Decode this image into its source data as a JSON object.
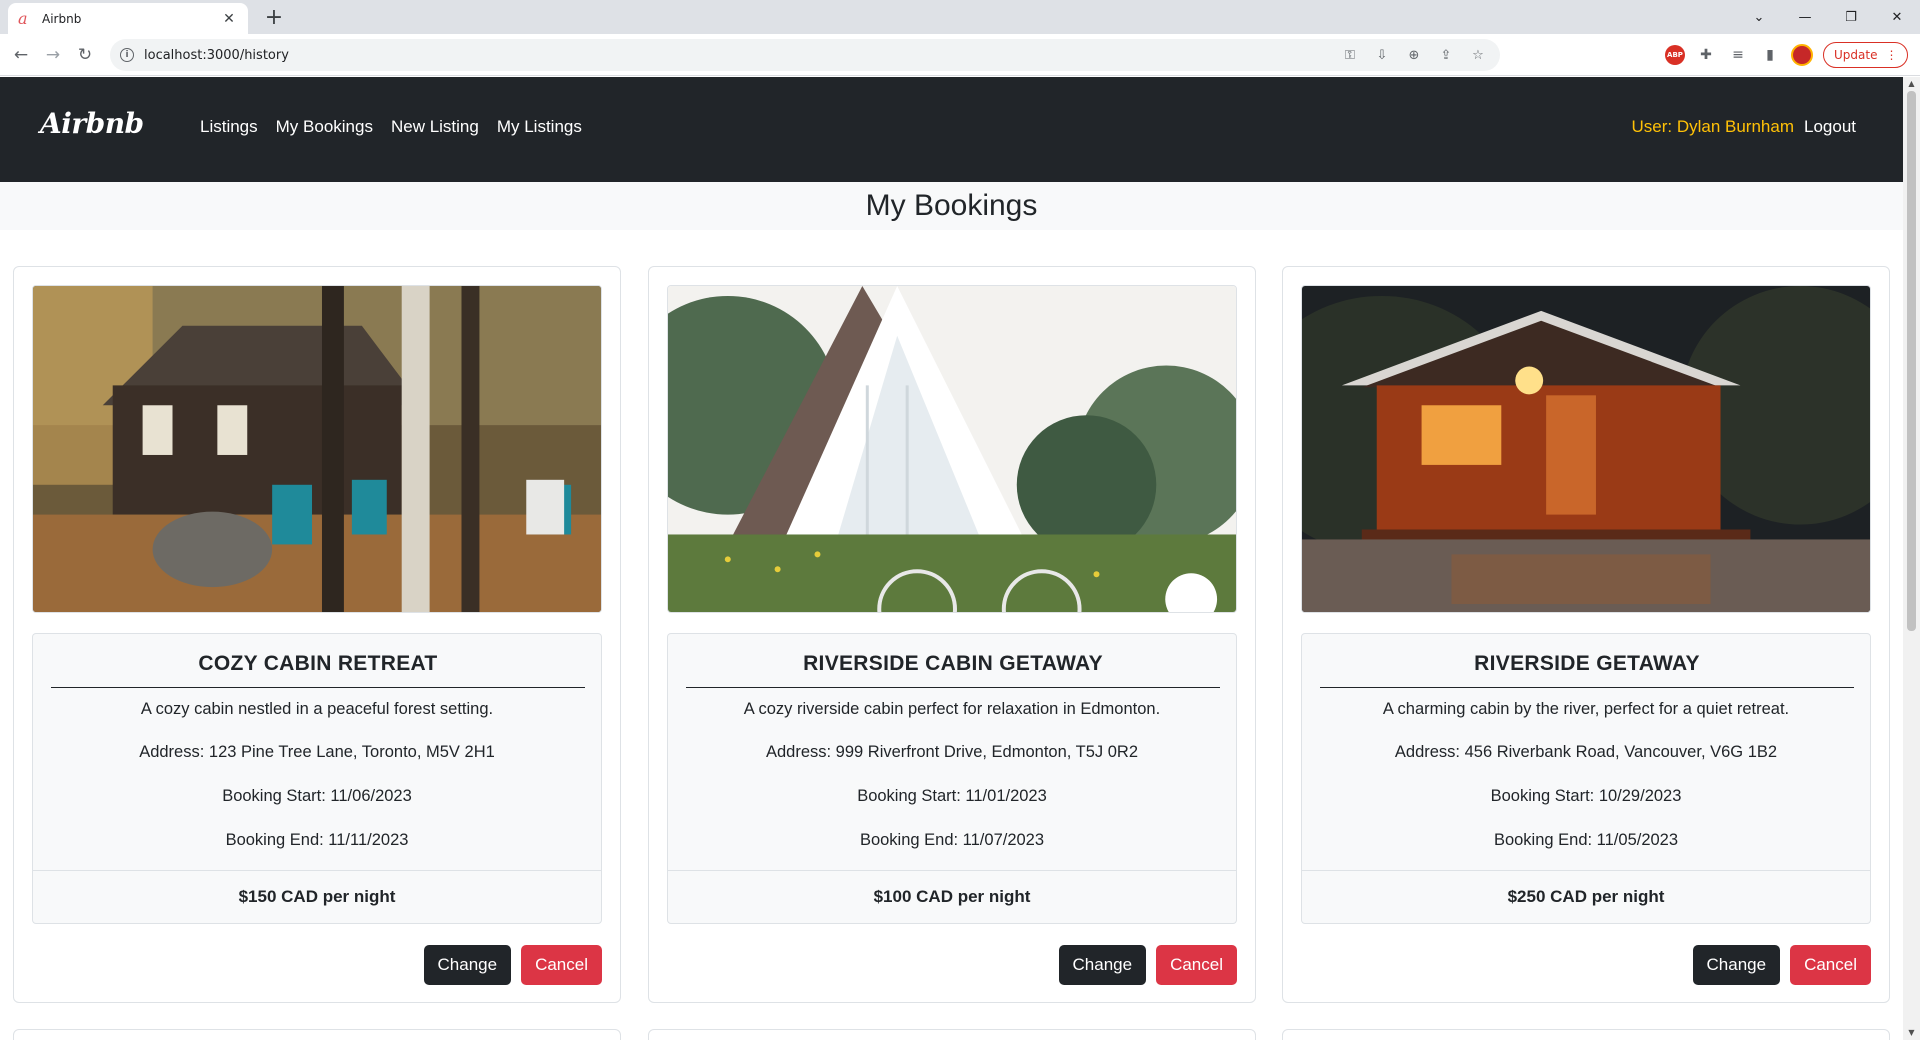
{
  "browser": {
    "tab_title": "Airbnb",
    "url": "localhost:3000/history",
    "update_label": "Update"
  },
  "navbar": {
    "brand": "Airbnb",
    "links": [
      "Listings",
      "My Bookings",
      "New Listing",
      "My Listings"
    ],
    "user": "User: Dylan Burnham",
    "logout": "Logout"
  },
  "page": {
    "title": "My Bookings"
  },
  "bookings": [
    {
      "title": "COZY CABIN RETREAT",
      "description": "A cozy cabin nestled in a peaceful forest setting.",
      "address": "Address: 123 Pine Tree Lane, Toronto, M5V 2H1",
      "start": "Booking Start: 11/06/2023",
      "end": "Booking End: 11/11/2023",
      "price": "$150 CAD per night",
      "change_label": "Change",
      "cancel_label": "Cancel"
    },
    {
      "title": "RIVERSIDE CABIN GETAWAY",
      "description": "A cozy riverside cabin perfect for relaxation in Edmonton.",
      "address": "Address: 999 Riverfront Drive, Edmonton, T5J 0R2",
      "start": "Booking Start: 11/01/2023",
      "end": "Booking End: 11/07/2023",
      "price": "$100 CAD per night",
      "change_label": "Change",
      "cancel_label": "Cancel"
    },
    {
      "title": "RIVERSIDE GETAWAY",
      "description": "A charming cabin by the river, perfect for a quiet retreat.",
      "address": "Address: 456 Riverbank Road, Vancouver, V6G 1B2",
      "start": "Booking Start: 10/29/2023",
      "end": "Booking End: 11/05/2023",
      "price": "$250 CAD per night",
      "change_label": "Change",
      "cancel_label": "Cancel"
    }
  ],
  "colors": {
    "navbar_bg": "#212529",
    "user_accent": "#ffc107",
    "cancel_red": "#dc3545"
  }
}
